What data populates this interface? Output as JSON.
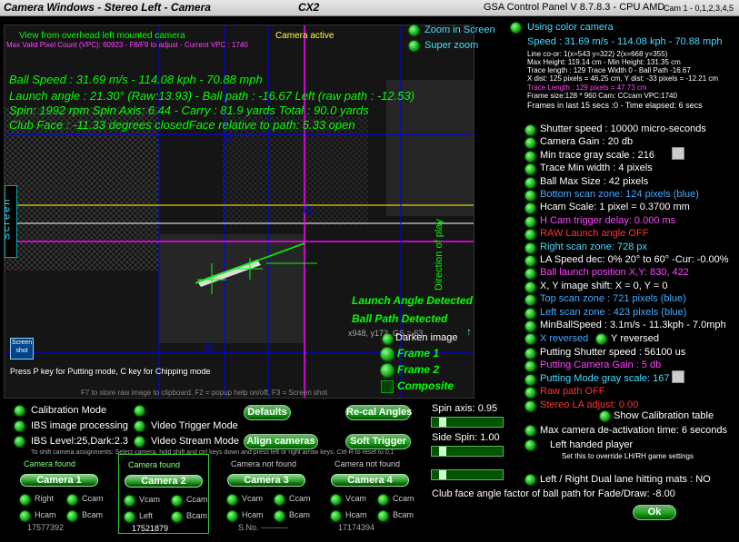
{
  "titlebar": {
    "left": "Camera Windows - Stereo Left - Camera",
    "cx": "CX2",
    "center": "GSA Control Panel V 8.7.8.3 - CPU AMD",
    "right": "Cam 1 - 0,1,2,3,4,5"
  },
  "camera": {
    "view_title": "View from overhead left mounted camera",
    "vpc": "Max Valid Pixel Count (VPC): 60923 - F8/F9 to adjust - Current VPC : 1740",
    "active": "Camera active",
    "stats": [
      "Ball Speed : 31.69 m/s - 114.08 kph - 70.88 mph",
      "Launch angle : 21.30° (Raw:13.93) - Ball path : -16.67 Left (raw path : -12.53)",
      "Spin: 1992 rpm  Spin Axis: 6.44 - Carry : 81.9 yards  Total : 90.0 yards",
      "Club Face : -11.33 degrees closedFace relative to path: 5.33 open"
    ],
    "screen_label": "Screen",
    "direction_label": "Direction of play",
    "launch_detected": "Launch Angle Detected",
    "path_detected": "Ball Path Detected",
    "coords": "x948, y172, GS = 63",
    "putting_hint": "Press P key for Putting mode, C key for Chipping mode",
    "footer_hint": "F7 to store raw image to clipboard, F2 = popup help on/off, F3 = Screen shot",
    "screenshot_label": "Screen shot",
    "darken": "Darken image",
    "frame1": "Frame 1",
    "frame2": "Frame 2",
    "composite": "Composite"
  },
  "top_opts": {
    "zoom": "Zoom in Screen",
    "super": "Super zoom"
  },
  "info": {
    "color_cam": "Using color camera",
    "speed": "Speed : 31.69 m/s - 114.08 kph - 70.88 mph",
    "lines": [
      "Line co-or: 1(x=543 y=322) 2(x=668 y=355)",
      "Max Height: 119.14 cm - Min Height: 131.35 cm",
      "Trace length : 129 Trace Width 0 - Ball Path -16.67",
      "X dist: 125 pixels = 46.25 cm, Y dist: -33 pixels = -12.21 cm"
    ],
    "trace_len": "Trace Length : 129 pixels = 47.73 cm",
    "lines2": [
      "Frame size:128 * 960 Cam: CCcam VPC:1740",
      "Frames in last 15 secs :0 - Time elapsed:  6 secs"
    ]
  },
  "settings": [
    {
      "t": "Shutter speed : 10000 micro-seconds",
      "c": "w"
    },
    {
      "t": "Camera Gain : 20 db",
      "c": "w"
    },
    {
      "t": "Min trace gray scale : 216",
      "c": "w"
    },
    {
      "t": "Trace Min width : 4 pixels",
      "c": "w"
    },
    {
      "t": "Ball Max Size : 42 pixels",
      "c": "w"
    },
    {
      "t": "Bottom scan zone: 124 pixels (blue)",
      "c": "b"
    },
    {
      "t": "Hcam Scale: 1 pixel = 0.3700 mm",
      "c": "w"
    },
    {
      "t": "H Cam trigger delay: 0.000 ms",
      "c": "m"
    },
    {
      "t": "RAW Launch angle OFF",
      "c": "r"
    },
    {
      "t": "Right scan zone: 728 px",
      "c": "c"
    },
    {
      "t": "LA Speed dec: 0% 20° to 60° -Cur: -0.00%",
      "c": "w"
    },
    {
      "t": "Ball launch position X,Y: 830, 422",
      "c": "m"
    },
    {
      "t": "X, Y image shift: X = 0, Y = 0",
      "c": "w"
    },
    {
      "t": "Top scan zone : 721 pixels (blue)",
      "c": "b"
    },
    {
      "t": "Left scan zone : 423 pixels (blue)",
      "c": "b"
    },
    {
      "t": "MinBallSpeed : 3.1m/s - 11.3kph - 7.0mph",
      "c": "w"
    }
  ],
  "xrev": "X reversed",
  "yrev": "Y reversed",
  "settings2": [
    {
      "t": "Putting Shutter speed : 56100 us",
      "c": "w"
    },
    {
      "t": "Putting Camera Gain : 5 db",
      "c": "m"
    },
    {
      "t": "Putting Mode gray scale: 167",
      "c": "c"
    },
    {
      "t": "Raw path OFF",
      "c": "r"
    },
    {
      "t": "Stereo LA adjust: 0.00",
      "c": "r"
    }
  ],
  "show_cal": "Show Calibration table",
  "max_deact": "Max camera de-activation time: 6 seconds",
  "left_handed": "Left handed player",
  "lh_hint": "Set this to override LH/RH game settings",
  "dual_lane": "Left / Right Dual lane hitting mats : NO",
  "clubface": "Club face angle factor of ball path for Fade/Draw: -8.00",
  "ok": "Ok",
  "bottom": {
    "calib": "Calibration Mode",
    "ibs": "IBS image processing",
    "ibs_level": "IBS Level:25,Dark:2.3",
    "video_trigger": "Video Trigger Mode",
    "video_stream": "Video Stream Mode",
    "defaults": "Defaults",
    "recal": "Re-cal Angles",
    "align": "Align cameras",
    "soft": "Soft Trigger",
    "hint": "To shift camera assignments: Select camera, hold shift and ctrl keys down and press left or right arrow keys. Ctrl-R to reset to 0,1",
    "spin_axis": "Spin axis: 0.95",
    "side_spin": "Side Spin: 1.00"
  },
  "cameras": [
    {
      "status": "Camera found",
      "name": "Camera 1",
      "a": "Right",
      "b": "Ccam",
      "c": "Hcam",
      "d": "Bcam",
      "serial": "17577392"
    },
    {
      "status": "Camera found",
      "name": "Camera 2",
      "a": "Vcam",
      "b": "Ccam",
      "c": "Left",
      "d": "Bcam",
      "serial": "17521879"
    },
    {
      "status": "Camera not found",
      "name": "Camera 3",
      "a": "Vcam",
      "b": "Ccam",
      "c": "Hcam",
      "d": "Bcam",
      "serial": "S.No. ----------"
    },
    {
      "status": "Camera not found",
      "name": "Camera 4",
      "a": "Vcam",
      "b": "Ccam",
      "c": "Hcam",
      "d": "Bcam",
      "serial": "17174394"
    }
  ]
}
